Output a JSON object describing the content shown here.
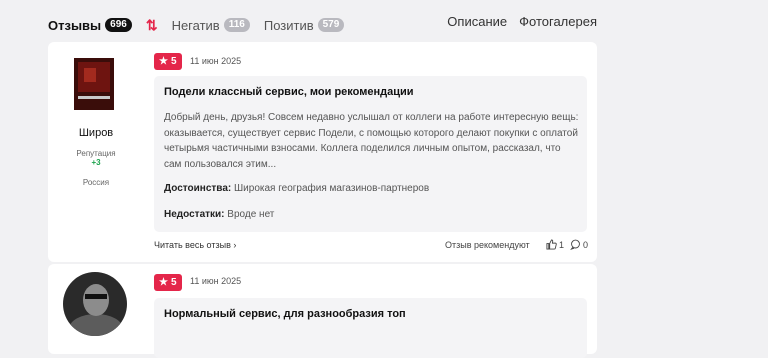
{
  "tabs": {
    "reviews": {
      "label": "Отзывы",
      "count": "696"
    },
    "negative": {
      "label": "Негатив",
      "count": "116"
    },
    "positive": {
      "label": "Позитив",
      "count": "579"
    },
    "sort_icon": "sort-arrows-icon"
  },
  "links": {
    "description": "Описание",
    "gallery": "Фотогалерея"
  },
  "reviews": [
    {
      "author": "Широв",
      "reputation_label": "Репутация",
      "reputation_value": "+3",
      "city": "Россия",
      "rating": "5",
      "date": "11 июн 2025",
      "title": "Подели классный сервис, мои рекомендации",
      "text": "Добрый день, друзья! Совсем недавно услышал от коллеги на работе интересную вещь: оказывается, существует сервис Подели, с помощью которого делают покупки с оплатой четырьмя частичными взносами. Коллега поделился личным опытом, рассказал, что сам пользовался этим...",
      "pros_label": "Достоинства:",
      "pros": "Широкая география магазинов-партнеров",
      "cons_label": "Недостатки:",
      "cons": "Вроде нет",
      "read_more": "Читать весь отзыв",
      "recommend": "Отзыв рекомендуют",
      "likes": "1",
      "comments": "0",
      "avatar_text": "MALIKETH"
    },
    {
      "rating": "5",
      "date": "11 июн 2025",
      "title": "Нормальный сервис, для разнообразия топ"
    }
  ],
  "colors": {
    "accent": "#e4264a",
    "reputation": "#1ca34d",
    "background": "#f1f1f3"
  }
}
